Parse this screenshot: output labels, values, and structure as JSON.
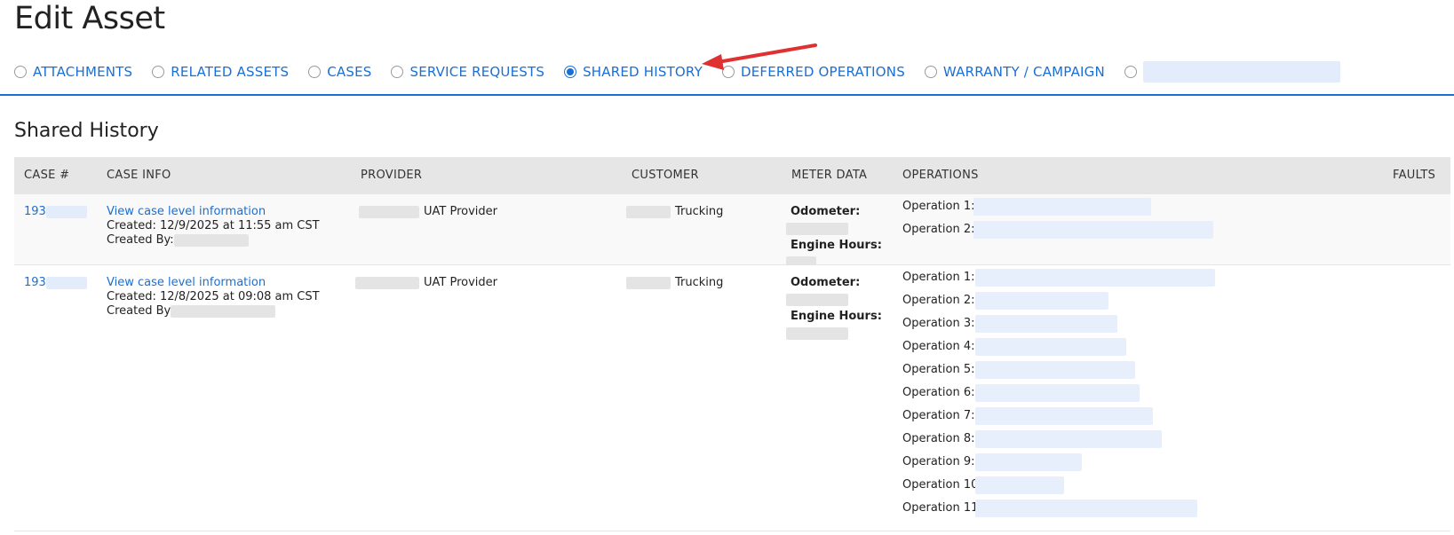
{
  "page": {
    "title": "Edit Asset"
  },
  "tabs": [
    {
      "label": "ATTACHMENTS",
      "selected": false
    },
    {
      "label": "RELATED ASSETS",
      "selected": false
    },
    {
      "label": "CASES",
      "selected": false
    },
    {
      "label": "SERVICE REQUESTS",
      "selected": false
    },
    {
      "label": "SHARED HISTORY",
      "selected": true
    },
    {
      "label": "DEFERRED OPERATIONS",
      "selected": false
    },
    {
      "label": "WARRANTY / CAMPAIGN",
      "selected": false
    },
    {
      "label": "",
      "selected": false
    }
  ],
  "colors": {
    "accent": "#1a6fd6",
    "arrow": "#e03131",
    "header_bg": "#e6e6e6"
  },
  "section": {
    "title": "Shared History"
  },
  "table": {
    "columns": [
      "CASE #",
      "CASE INFO",
      "PROVIDER",
      "CUSTOMER",
      "METER DATA",
      "OPERATIONS",
      "FAULTS"
    ],
    "rows": [
      {
        "case_prefix": "193",
        "case_link": "View case level information",
        "created": "Created: 12/9/2025 at 11:55 am CST",
        "created_by": "Created By:",
        "provider": "UAT Provider",
        "customer": "Trucking",
        "odometer_label": "Odometer:",
        "engine_hours_label": "Engine Hours:",
        "operations": [
          "Operation 1:",
          "Operation 2:"
        ]
      },
      {
        "case_prefix": "193",
        "case_link": "View case level information",
        "created": "Created: 12/8/2025 at 09:08 am CST",
        "created_by": "Created By",
        "provider": "UAT Provider",
        "customer": "Trucking",
        "odometer_label": "Odometer:",
        "engine_hours_label": "Engine Hours:",
        "operations": [
          "Operation 1:",
          "Operation 2:",
          "Operation 3:",
          "Operation 4:",
          "Operation 5:",
          "Operation 6:",
          "Operation 7:",
          "Operation 8:",
          "Operation 9:",
          "Operation 10",
          "Operation 11:"
        ]
      }
    ]
  }
}
